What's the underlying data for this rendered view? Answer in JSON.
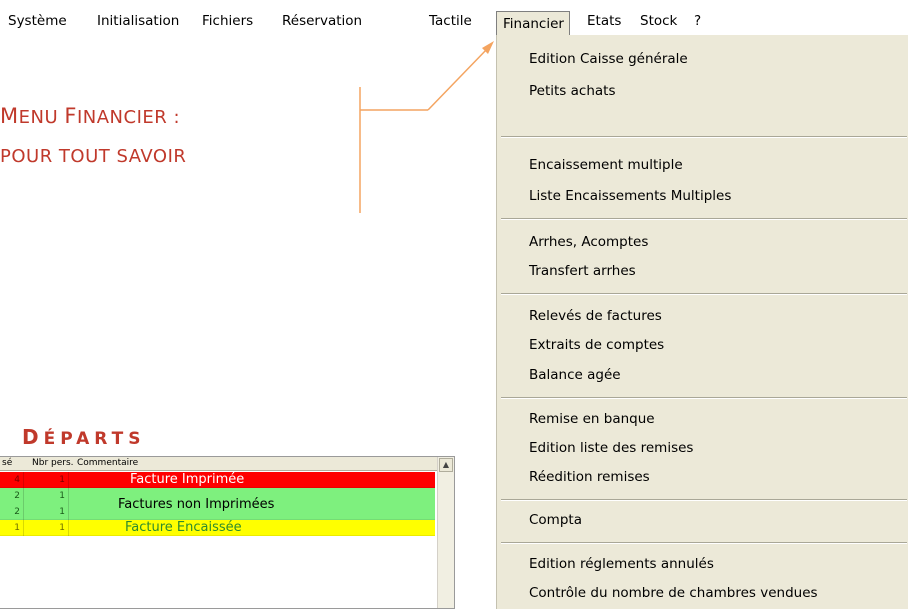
{
  "menubar": {
    "items": [
      {
        "label": "Système"
      },
      {
        "label": "Initialisation"
      },
      {
        "label": "Fichiers"
      },
      {
        "label": "Réservation"
      },
      {
        "label": "Tactile"
      },
      {
        "label": "Financier",
        "active": true
      },
      {
        "label": "Etats"
      },
      {
        "label": "Stock"
      },
      {
        "label": "?"
      }
    ]
  },
  "dropdown": {
    "items": [
      {
        "label": "Edition Caisse générale"
      },
      {
        "label": "Petits achats"
      },
      {
        "label": "Encaissement multiple"
      },
      {
        "label": "Liste Encaissements Multiples"
      },
      {
        "label": "Arrhes, Acomptes"
      },
      {
        "label": "Transfert arrhes"
      },
      {
        "label": "Relevés de factures"
      },
      {
        "label": "Extraits de comptes"
      },
      {
        "label": "Balance agée"
      },
      {
        "label": "Remise en banque"
      },
      {
        "label": "Edition liste des remises"
      },
      {
        "label": "Réedition remises"
      },
      {
        "label": "Compta"
      },
      {
        "label": "Edition réglements annulés"
      },
      {
        "label": "Contrôle du nombre de chambres vendues"
      }
    ]
  },
  "annotation": {
    "line1_cap1": "M",
    "line1_rest1": "ENU ",
    "line1_cap2": "F",
    "line1_rest2": "INANCIER :",
    "line2": "POUR TOUT SAVOIR",
    "color": "#c0392b",
    "arrow_color": "#f4a460"
  },
  "departs": {
    "cap": "D",
    "rest": "ÉPARTS"
  },
  "grid": {
    "headers": {
      "col1": "sé",
      "col2": "Nbr pers.",
      "col3": "Commentaire"
    },
    "rows": [
      {
        "a": "4",
        "b": "1",
        "comment": "Facture Imprimée",
        "color": "#ff0000",
        "text_color": "#ffffff"
      },
      {
        "a": "2",
        "b": "1",
        "comment": "",
        "color": "#7ef07e",
        "text_color": "#000000"
      },
      {
        "a": "2",
        "b": "1",
        "comment": "",
        "color": "#7ef07e",
        "text_color": "#000000"
      },
      {
        "a": "1",
        "b": "1",
        "comment": "Facture Encaissée",
        "color": "#ffff00",
        "text_color": "#2e8b2e"
      }
    ],
    "merged_comment": "Factures non Imprimées"
  }
}
